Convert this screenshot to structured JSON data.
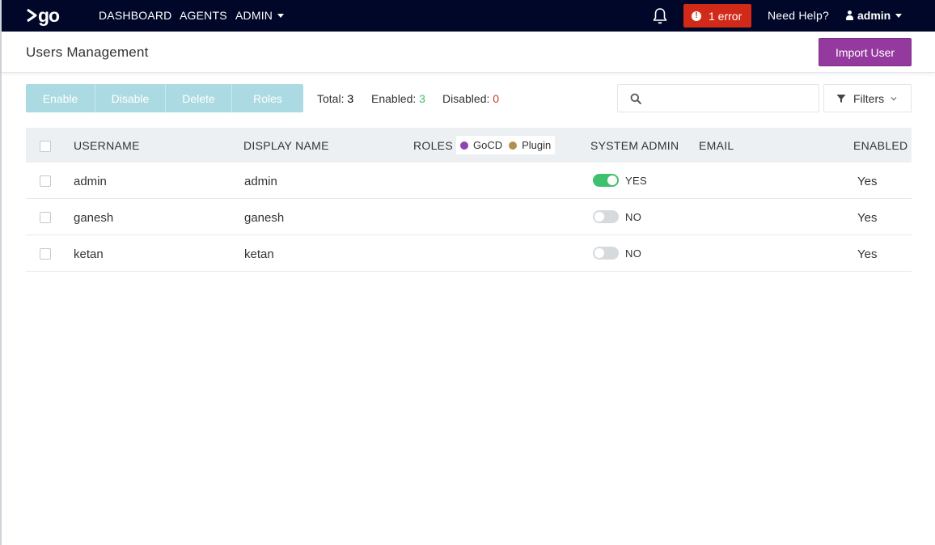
{
  "nav": {
    "logo_text": "go",
    "links": [
      "DASHBOARD",
      "AGENTS",
      "ADMIN"
    ],
    "error_label": "1 error",
    "help_label": "Need Help?",
    "user_label": "admin",
    "colors": {
      "bg": "#000728",
      "error": "#d12a19"
    }
  },
  "header": {
    "title": "Users Management",
    "import_button": "Import User",
    "accent": "#943a9e"
  },
  "toolbar": {
    "buttons": [
      "Enable",
      "Disable",
      "Delete",
      "Roles"
    ],
    "total_label": "Total:",
    "total": "3",
    "enabled_label": "Enabled:",
    "enabled": "3",
    "disabled_label": "Disabled:",
    "disabled": "0",
    "search_value": "",
    "filters_label": "Filters"
  },
  "table": {
    "headers": {
      "username": "USERNAME",
      "display_name": "DISPLAY NAME",
      "roles": "ROLES",
      "system_admin": "SYSTEM ADMIN",
      "email": "EMAIL",
      "enabled": "ENABLED"
    },
    "role_legend": [
      {
        "name": "GoCD",
        "color": "#8e44ad"
      },
      {
        "name": "Plugin",
        "color": "#b38f4d"
      }
    ],
    "rows": [
      {
        "username": "admin",
        "display_name": "admin",
        "system_admin": "YES",
        "admin_on": true,
        "email": "",
        "enabled": "Yes"
      },
      {
        "username": "ganesh",
        "display_name": "ganesh",
        "system_admin": "NO",
        "admin_on": false,
        "email": "",
        "enabled": "Yes"
      },
      {
        "username": "ketan",
        "display_name": "ketan",
        "system_admin": "NO",
        "admin_on": false,
        "email": "",
        "enabled": "Yes"
      }
    ]
  }
}
